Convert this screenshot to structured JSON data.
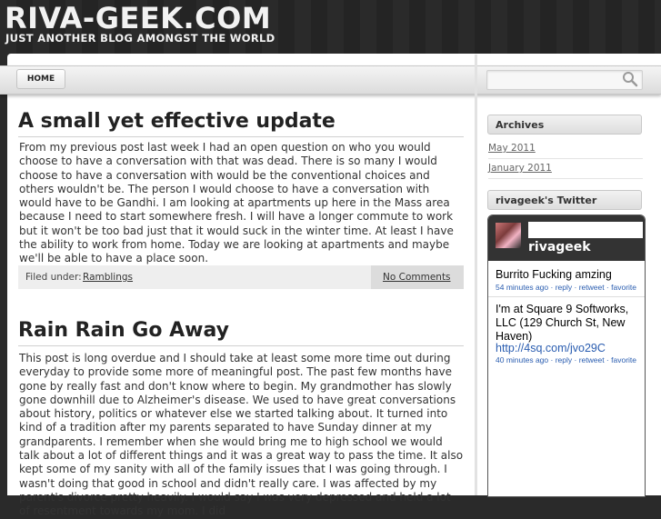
{
  "site": {
    "title": "RIVA-GEEK.COM",
    "tagline": "JUST ANOTHER BLOG AMONGST THE WORLD"
  },
  "nav": {
    "home_label": "HOME",
    "search_placeholder": ""
  },
  "posts": [
    {
      "title": "A small yet effective update",
      "body": "From my previous post last week I had an open question on who you would choose to have a conversation with that was dead. There is so many I would choose to have a conversation with would be the conventional choices and others wouldn't be. The person I would choose to have a conversation with would have to be Gandhi. I am looking at apartments up here in the Mass area because I need to start somewhere fresh. I will have a longer commute to work but it won't be too bad just that it would suck in the winter time. At least I have the ability to work from home. Today we are looking at apartments and maybe we'll be able to have a place soon.",
      "filed_label": "Filed under:",
      "category": "Ramblings",
      "comments": "No Comments"
    },
    {
      "title": "Rain Rain Go Away",
      "body": "This post is long overdue and I should take at least some more time out during everyday to provide some more of meaningful post. The past few months have gone by really fast and don't know where to begin. My grandmother has slowly gone downhill due to Alzheimer's disease. We used to have great conversations about history, politics or whatever else we started talking about. It turned into kind of a tradition after my parents separated to have Sunday dinner at my grandparents. I remember when she would bring me to high school we would talk about a lot of different things and it was a great way to pass the time. It also kept some of my sanity with all of the family issues that I was going through. I wasn't doing that good in school and didn't really care. I was affected by my parent's divorce pretty heavily. I would say I was very depressed and held a lot of resentment towards my mom. I did"
    }
  ],
  "sidebar": {
    "archives_title": "Archives",
    "archives": [
      "May 2011",
      "January 2011"
    ],
    "twitter_title": "rivageek's Twitter",
    "twitter_user": "rivageek",
    "tweets": [
      {
        "text": "Burrito Fucking amzing",
        "time": "54 minutes ago",
        "reply": "reply",
        "retweet": "retweet",
        "favorite": "favorite"
      },
      {
        "text": "I'm at Square 9 Softworks, LLC (129 Church St, New Haven)",
        "link": "http://4sq.com/jvo29C",
        "time": "40 minutes ago",
        "reply": "reply",
        "retweet": "retweet",
        "favorite": "favorite"
      }
    ]
  },
  "colors": {
    "background": "#2a2a2a",
    "link": "#2a5db0",
    "title": "#222222"
  }
}
